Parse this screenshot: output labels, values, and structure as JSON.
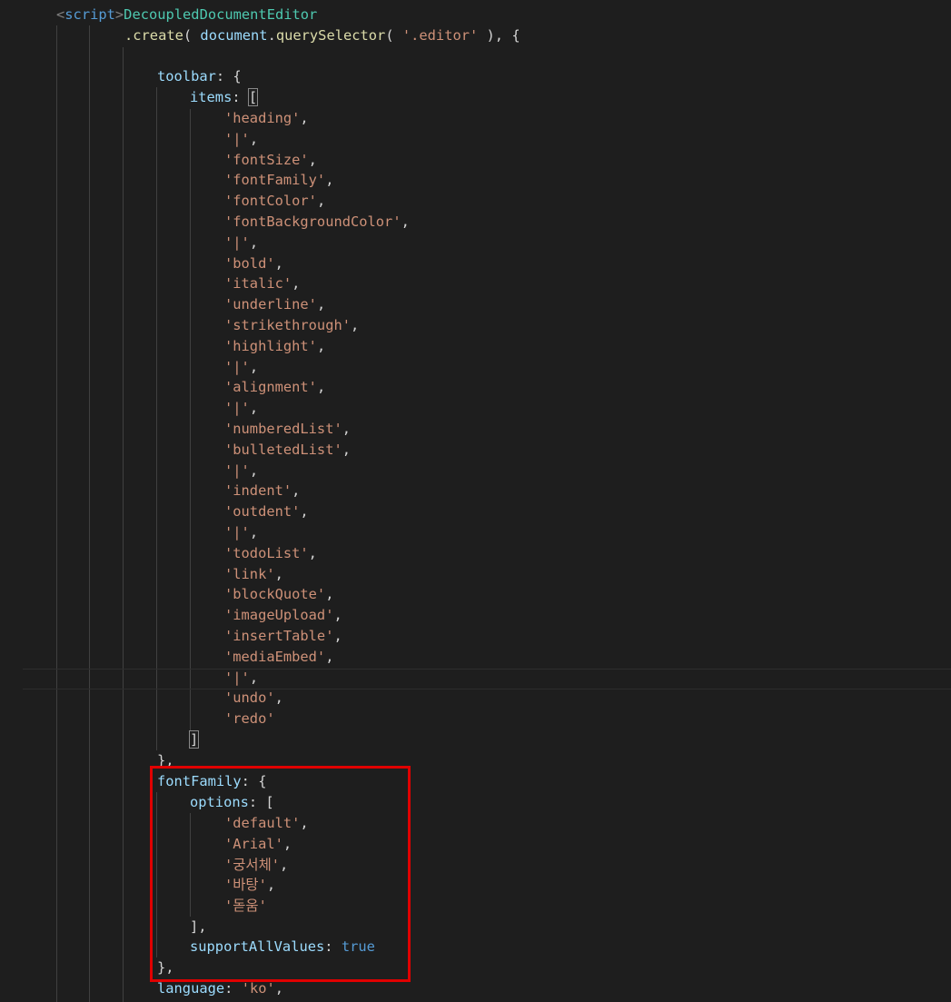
{
  "code": {
    "line0": {
      "open": "<",
      "tag": "script",
      "close": ">",
      "ident": "DecoupledDocumentEditor"
    },
    "line1": {
      "method": ".create",
      "open": "( ",
      "obj": "document",
      "dot": ".",
      "fn": "querySelector",
      "p1": "( ",
      "str": "'.editor'",
      "p2": " ), {"
    },
    "toolbar_key": "toolbar",
    "toolbar_open": ": {",
    "items_key": "items",
    "items_open": ": ",
    "items_bracket_open": "[",
    "items": [
      "'heading'",
      "'|'",
      "'fontSize'",
      "'fontFamily'",
      "'fontColor'",
      "'fontBackgroundColor'",
      "'|'",
      "'bold'",
      "'italic'",
      "'underline'",
      "'strikethrough'",
      "'highlight'",
      "'|'",
      "'alignment'",
      "'|'",
      "'numberedList'",
      "'bulletedList'",
      "'|'",
      "'indent'",
      "'outdent'",
      "'|'",
      "'todoList'",
      "'link'",
      "'blockQuote'",
      "'imageUpload'",
      "'insertTable'",
      "'mediaEmbed'",
      "'|'",
      "'undo'",
      "'redo'"
    ],
    "comma": ",",
    "items_bracket_close": "]",
    "toolbar_close": "},",
    "fontfamily_key": "fontFamily",
    "fontfamily_open": ": {",
    "options_key": "options",
    "options_open": ": [",
    "options": [
      "'default'",
      "'Arial'",
      "'궁서체'",
      "'바탕'",
      "'돋움'"
    ],
    "options_close": "],",
    "support_key": "supportAllValues",
    "support_colon": ": ",
    "support_value": "true",
    "fontfamily_close": "},",
    "language_key": "language",
    "language_colon": ": ",
    "language_value": "'ko'",
    "language_comma": ","
  },
  "colors": {
    "background": "#1e1e1e",
    "highlight_box": "#e00000",
    "string": "#ce9178",
    "property": "#9cdcfe",
    "keyword": "#569cd6"
  }
}
